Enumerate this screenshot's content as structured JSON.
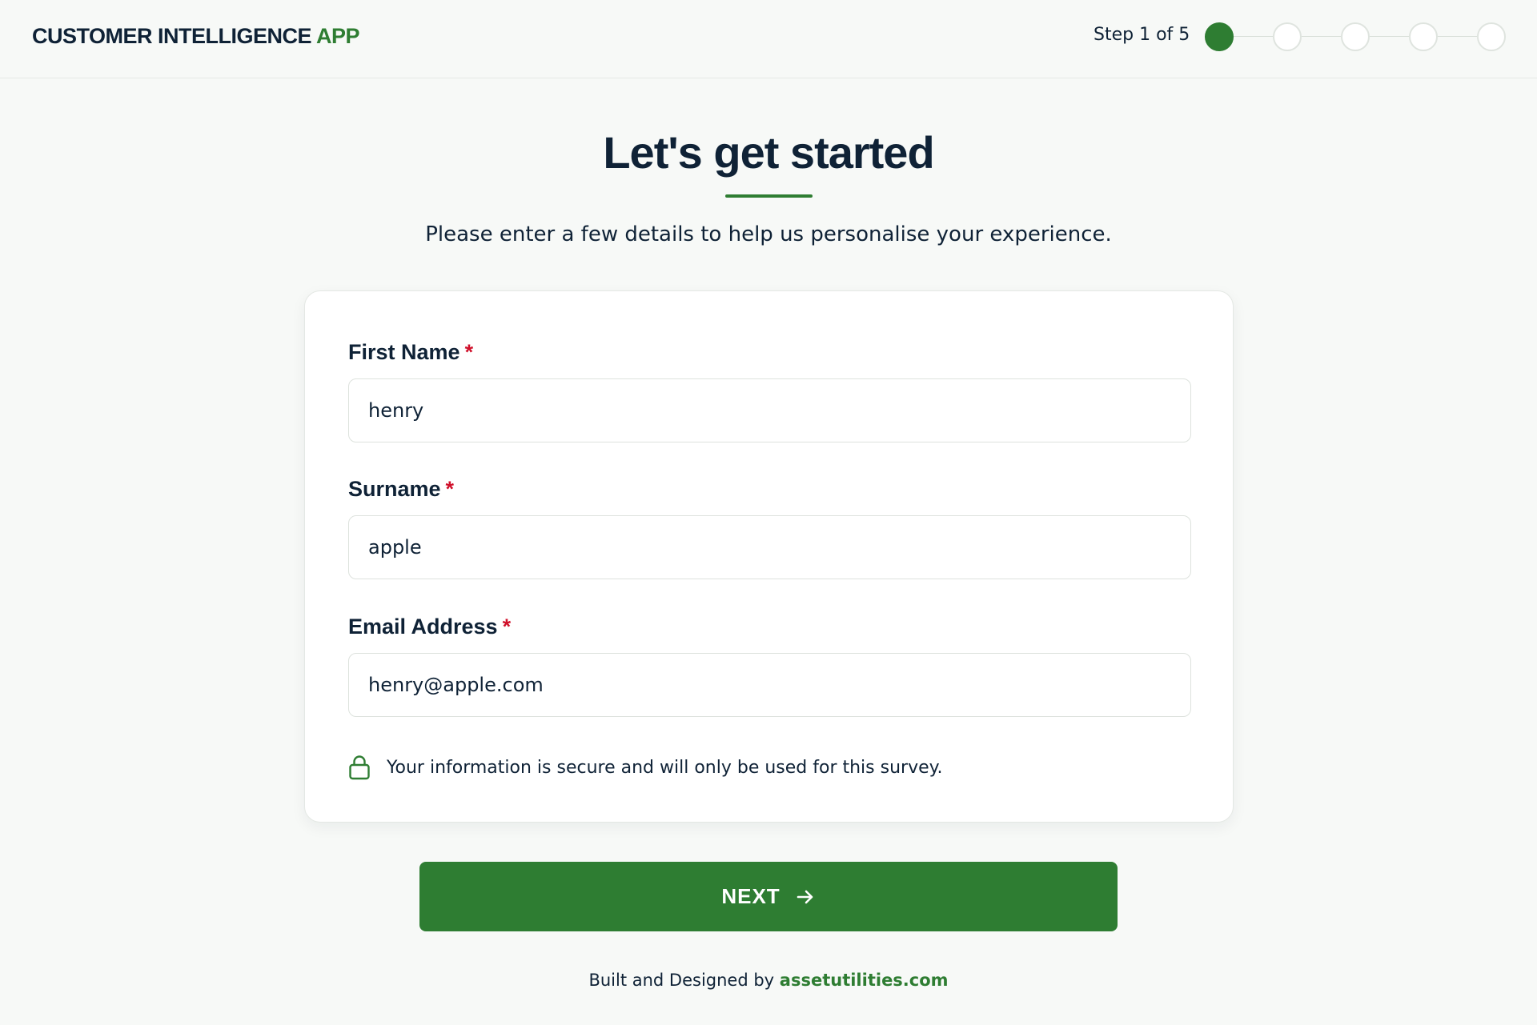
{
  "header": {
    "brand_main": "CUSTOMER INTELLIGENCE",
    "brand_accent": "APP",
    "step_label": "Step 1 of 5",
    "steps_total": 5,
    "current_step": 1
  },
  "hero": {
    "title": "Let's get started",
    "subtitle": "Please enter a few details to help us personalise your experience."
  },
  "form": {
    "first_name": {
      "label": "First Name",
      "required_mark": "*",
      "value": "henry"
    },
    "surname": {
      "label": "Surname",
      "required_mark": "*",
      "value": "apple"
    },
    "email": {
      "label": "Email Address",
      "required_mark": "*",
      "value": "henry@apple.com"
    },
    "secure_note": "Your information is secure and will only be used for this survey.",
    "secure_icon": "lock-icon"
  },
  "actions": {
    "next_label": "NEXT",
    "next_icon": "arrow-right-icon"
  },
  "footer": {
    "prefix": "Built and Designed by",
    "link_text": "assetutilities.com"
  },
  "colors": {
    "accent": "#2e7d32",
    "text": "#0f2236",
    "required": "#d0112b",
    "background": "#f7f9f7"
  }
}
